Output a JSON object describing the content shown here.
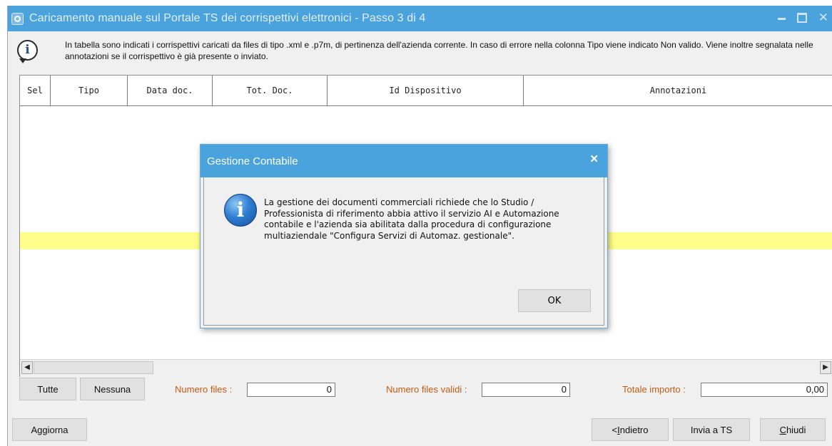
{
  "window": {
    "title": "Caricamento manuale sul Portale TS dei corrispettivi elettronici - Passo 3 di 4",
    "controls": {
      "minimize": "–",
      "maximize": "□",
      "close": "✕"
    }
  },
  "info": {
    "text": "In tabella sono indicati i corrispettivi caricati da files di tipo .xml e .p7m, di pertinenza dell'azienda corrente. In caso di errore nella colonna Tipo viene indicato Non valido. Viene inoltre segnalata nelle annotazioni se il corrispettivo è già presente o inviato."
  },
  "grid": {
    "columns": [
      "Sel",
      "Tipo",
      "Data doc.",
      "Tot. Doc.",
      "Id Dispositivo",
      "Annotazioni"
    ],
    "rows": [],
    "highlight_color": "#fffe8a"
  },
  "selection": {
    "all_label": "Tutte",
    "none_label": "Nessuna"
  },
  "summary": {
    "files_label": "Numero files :",
    "files_value": "0",
    "valid_label": "Numero files validi :",
    "valid_value": "0",
    "total_label": "Totale importo :",
    "total_value": "0,00"
  },
  "footer": {
    "refresh_label": "Aggiorna",
    "back_label_prefix": "< ",
    "back_label_key": "I",
    "back_label_rest": "ndietro",
    "send_label": "Invia a TS",
    "close_label_key": "C",
    "close_label_rest": "hiudi"
  },
  "dialog": {
    "title": "Gestione Contabile",
    "close": "✕",
    "message": "La gestione dei documenti commerciali richiede che lo Studio / Professionista di riferimento abbia attivo il servizio AI e Automazione contabile e l'azienda sia abilitata dalla procedura di configurazione multiaziendale \"Configura Servizi di Automaz. gestionale\".",
    "ok_label": "OK"
  },
  "colors": {
    "titlebar": "#4aa3dd",
    "label_orange": "#c45a10",
    "window_bg": "#f0f0f0"
  }
}
